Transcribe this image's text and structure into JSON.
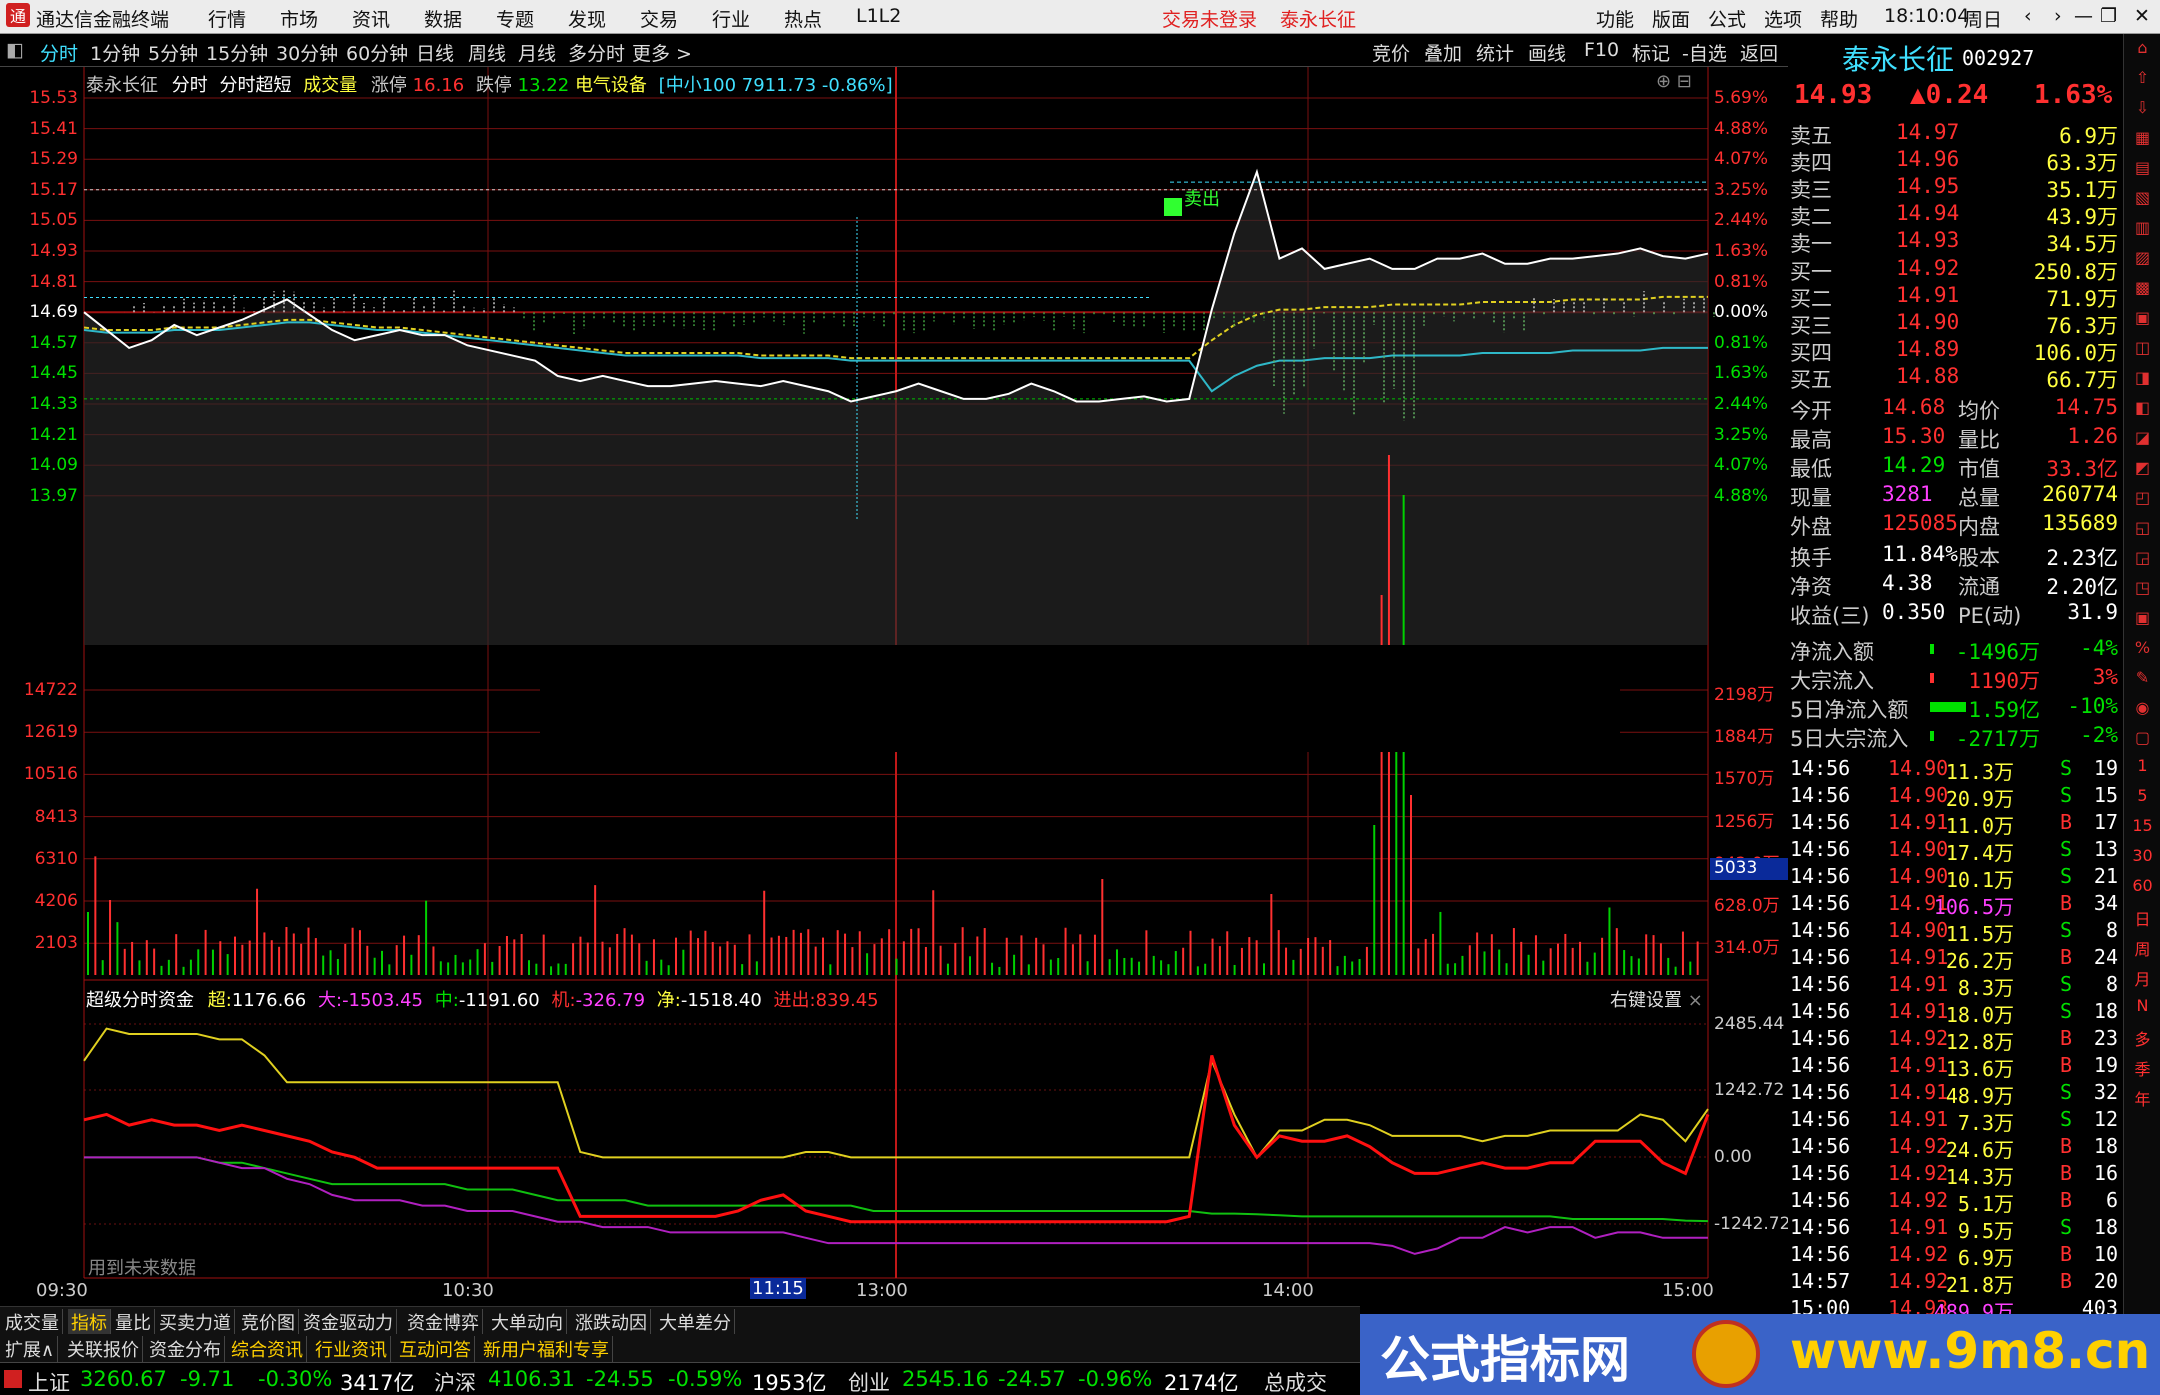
{
  "app": {
    "title": "通达信金融终端",
    "login_status": "交易未登录",
    "stock_link": "泰永长征",
    "time": "18:10:04",
    "weekday": "周日"
  },
  "menu": [
    "行情",
    "市场",
    "资讯",
    "数据",
    "专题",
    "发现",
    "交易",
    "行业",
    "热点",
    "L1L2"
  ],
  "menu_right": [
    "功能",
    "版面",
    "公式",
    "选项",
    "帮助"
  ],
  "periods": [
    "分时",
    "1分钟",
    "5分钟",
    "15分钟",
    "30分钟",
    "60分钟",
    "日线",
    "周线",
    "月线",
    "多分时",
    "更多 >"
  ],
  "tools": [
    "竞价",
    "叠加",
    "统计",
    "画线",
    "F10",
    "标记",
    "-自选",
    "返回"
  ],
  "chart_header": {
    "name": "泰永长征",
    "mode": "分时",
    "mode2": "分时超短",
    "vol_label": "成交量",
    "zt_label": "涨停",
    "zt": "16.16",
    "dt_label": "跌停",
    "dt": "13.22",
    "sector": "电气设备",
    "index": "[中小100 7911.73 -0.86%]"
  },
  "price_axis": [
    "15.53",
    "15.41",
    "15.29",
    "15.17",
    "15.05",
    "14.93",
    "14.81",
    "14.69",
    "14.57",
    "14.45",
    "14.33",
    "14.21",
    "14.09",
    "13.97"
  ],
  "pct_axis": [
    "5.69%",
    "4.88%",
    "4.07%",
    "3.25%",
    "2.44%",
    "1.63%",
    "0.81%",
    "0.00%",
    "0.81%",
    "1.63%",
    "2.44%",
    "3.25%",
    "4.07%",
    "4.88%"
  ],
  "vol_axis_left": [
    "14722",
    "12619",
    "10516",
    "8413",
    "6310",
    "4206",
    "2103"
  ],
  "vol_axis_right": [
    "2198万",
    "1884万",
    "1570万",
    "1256万",
    "942.0万",
    "628.0万",
    "314.0万"
  ],
  "vol_badge": "5033",
  "fund_axis": [
    "2485.44",
    "1242.72",
    "0.00",
    "-1242.72"
  ],
  "fund_legend": {
    "title": "超级分时资金",
    "super_label": "超:",
    "super": "1176.66",
    "big_label": "大:",
    "big": "-1503.45",
    "mid_label": "中:",
    "mid": "-1191.60",
    "inst_label": "机:",
    "inst": "-326.79",
    "net_label": "净:",
    "net": "-1518.40",
    "in_out_label": "进出:",
    "in_out": "839.45",
    "settings": "右键设置"
  },
  "future_note": "用到未来数据",
  "time_axis": [
    "09:30",
    "10:30",
    "11:15",
    "13:00",
    "14:00",
    "15:00"
  ],
  "signal_label": "卖出",
  "quote": {
    "name": "泰永长征",
    "code": "002927",
    "price": "14.93",
    "change": "▲0.24",
    "pct": "1.63%",
    "asks": [
      [
        "卖五",
        "14.97",
        "6.9万"
      ],
      [
        "卖四",
        "14.96",
        "63.3万"
      ],
      [
        "卖三",
        "14.95",
        "35.1万"
      ],
      [
        "卖二",
        "14.94",
        "43.9万"
      ],
      [
        "卖一",
        "14.93",
        "34.5万"
      ]
    ],
    "bids": [
      [
        "买一",
        "14.92",
        "250.8万"
      ],
      [
        "买二",
        "14.91",
        "71.9万"
      ],
      [
        "买三",
        "14.90",
        "76.3万"
      ],
      [
        "买四",
        "14.89",
        "106.0万"
      ],
      [
        "买五",
        "14.88",
        "66.7万"
      ]
    ],
    "stats": [
      [
        "今开",
        "14.68",
        "均价",
        "14.75"
      ],
      [
        "最高",
        "15.30",
        "量比",
        "1.26"
      ],
      [
        "最低",
        "14.29",
        "市值",
        "33.3亿"
      ],
      [
        "现量",
        "3281",
        "总量",
        "260774"
      ],
      [
        "外盘",
        "125085",
        "内盘",
        "135689"
      ]
    ],
    "stats2": [
      [
        "换手",
        "11.84%",
        "股本",
        "2.23亿"
      ],
      [
        "净资",
        "4.38",
        "流通",
        "2.20亿"
      ],
      [
        "收益(三)",
        "0.350",
        "PE(动)",
        "31.9"
      ]
    ],
    "flows": [
      [
        "净流入额",
        "-1496万",
        "-4%"
      ],
      [
        "大宗流入",
        "1190万",
        "3%"
      ],
      [
        "5日净流入额",
        "-1.59亿",
        "-10%"
      ],
      [
        "5日大宗流入",
        "-2717万",
        "-2%"
      ]
    ],
    "ticks": [
      [
        "14:56",
        "14.90",
        "11.3万",
        "S",
        "19"
      ],
      [
        "14:56",
        "14.90",
        "20.9万",
        "S",
        "15"
      ],
      [
        "14:56",
        "14.91",
        "11.0万",
        "B",
        "17"
      ],
      [
        "14:56",
        "14.90",
        "17.4万",
        "S",
        "13"
      ],
      [
        "14:56",
        "14.90",
        "10.1万",
        "S",
        "21"
      ],
      [
        "14:56",
        "14.91",
        "106.5万",
        "B",
        "34"
      ],
      [
        "14:56",
        "14.90",
        "11.5万",
        "S",
        "8"
      ],
      [
        "14:56",
        "14.91",
        "26.2万",
        "B",
        "24"
      ],
      [
        "14:56",
        "14.91",
        "8.3万",
        "S",
        "8"
      ],
      [
        "14:56",
        "14.91",
        "18.0万",
        "S",
        "18"
      ],
      [
        "14:56",
        "14.92",
        "12.8万",
        "B",
        "23"
      ],
      [
        "14:56",
        "14.91",
        "13.6万",
        "B",
        "19"
      ],
      [
        "14:56",
        "14.91",
        "48.9万",
        "S",
        "32"
      ],
      [
        "14:56",
        "14.91",
        "7.3万",
        "S",
        "12"
      ],
      [
        "14:56",
        "14.92",
        "24.6万",
        "B",
        "18"
      ],
      [
        "14:56",
        "14.92",
        "14.3万",
        "B",
        "16"
      ],
      [
        "14:56",
        "14.92",
        "5.1万",
        "B",
        "6"
      ],
      [
        "14:56",
        "14.91",
        "9.5万",
        "S",
        "18"
      ],
      [
        "14:56",
        "14.92",
        "6.9万",
        "B",
        "10"
      ],
      [
        "14:57",
        "14.92",
        "21.8万",
        "B",
        "20"
      ],
      [
        "15:00",
        "14.93",
        "489.9万",
        "",
        "403"
      ]
    ]
  },
  "side_icons": [
    "nav-up-icon",
    "nav-up2-icon",
    "nav-down-icon",
    "chart1-icon",
    "chart2-icon",
    "chart3-icon",
    "chart4-icon",
    "chart5-icon",
    "chart6-icon",
    "f10-icon",
    "f9-icon",
    "f2-icon",
    "f3-icon",
    "f4-icon",
    "f5-icon",
    "f6-icon",
    "f7-icon",
    "f8-icon",
    "f11-icon",
    "f12-icon",
    "pct-icon",
    "pen-icon",
    "zoom-icon",
    "f13-icon"
  ],
  "side_labels": [
    "1",
    "5",
    "15",
    "30",
    "60",
    "日",
    "周",
    "月",
    "N",
    "多",
    "季",
    "年"
  ],
  "bottom_tabs": [
    "成交量",
    "指标",
    "量比",
    "买卖力道",
    "竞价图",
    "资金驱动力",
    "资金博弈",
    "大单动向",
    "涨跌动因",
    "大单差分"
  ],
  "bottom_tabs2": [
    "扩展∧",
    "关联报价",
    "资金分布",
    "综合资讯",
    "行业资讯",
    "互动问答",
    "新用户福利专享"
  ],
  "status": [
    {
      "name": "上证",
      "val": "3260.67",
      "chg": "-9.71",
      "pct": "-0.30%",
      "amt": "3417亿"
    },
    {
      "name": "沪深",
      "val": "4106.31",
      "chg": "-24.55",
      "pct": "-0.59%",
      "amt": "1953亿"
    },
    {
      "name": "创业",
      "val": "2545.16",
      "chg": "-24.57",
      "pct": "-0.96%",
      "amt": "2174亿"
    }
  ],
  "status_tail": "总成交",
  "banner": {
    "text1": "公式指标网",
    "text2": "www.9m8.cn"
  },
  "chart_data": {
    "type": "line",
    "title": "泰永长征 分时",
    "prev_close": 14.69,
    "ylim": [
      13.97,
      15.53
    ],
    "price": [
      14.69,
      14.62,
      14.55,
      14.58,
      14.64,
      14.6,
      14.63,
      14.66,
      14.7,
      14.74,
      14.68,
      14.62,
      14.58,
      14.6,
      14.62,
      14.6,
      14.6,
      14.56,
      14.54,
      14.52,
      14.5,
      14.44,
      14.42,
      14.44,
      14.42,
      14.4,
      14.4,
      14.41,
      14.42,
      14.41,
      14.4,
      14.42,
      14.4,
      14.38,
      14.34,
      14.36,
      14.38,
      14.41,
      14.38,
      14.35,
      14.35,
      14.37,
      14.41,
      14.38,
      14.34,
      14.34,
      14.35,
      14.36,
      14.34,
      14.35,
      14.7,
      15.0,
      15.24,
      14.9,
      14.94,
      14.86,
      14.88,
      14.9,
      14.86,
      14.86,
      14.9,
      14.9,
      14.92,
      14.88,
      14.88,
      14.9,
      14.9,
      14.91,
      14.92,
      14.94,
      14.91,
      14.9,
      14.92
    ],
    "avg": [
      14.63,
      14.62,
      14.62,
      14.62,
      14.63,
      14.63,
      14.63,
      14.64,
      14.65,
      14.66,
      14.66,
      14.65,
      14.64,
      14.63,
      14.63,
      14.62,
      14.61,
      14.6,
      14.59,
      14.58,
      14.57,
      14.56,
      14.55,
      14.54,
      14.53,
      14.53,
      14.53,
      14.53,
      14.53,
      14.53,
      14.52,
      14.52,
      14.52,
      14.52,
      14.51,
      14.51,
      14.51,
      14.51,
      14.51,
      14.51,
      14.51,
      14.51,
      14.51,
      14.51,
      14.51,
      14.51,
      14.51,
      14.51,
      14.51,
      14.51,
      14.58,
      14.64,
      14.68,
      14.7,
      14.7,
      14.71,
      14.71,
      14.71,
      14.72,
      14.72,
      14.72,
      14.72,
      14.73,
      14.73,
      14.73,
      14.73,
      14.74,
      14.74,
      14.74,
      14.74,
      14.75,
      14.75,
      14.75
    ],
    "vol_ylim": [
      0,
      16825
    ],
    "fund_ylim": [
      -1600,
      2600
    ],
    "super": [
      1800,
      2400,
      2300,
      2300,
      2300,
      2300,
      2200,
      2200,
      1900,
      1400,
      1400,
      1400,
      1400,
      1400,
      1400,
      1400,
      1400,
      1400,
      1400,
      1400,
      1400,
      1400,
      100,
      0,
      0,
      0,
      0,
      0,
      0,
      0,
      0,
      0,
      100,
      100,
      0,
      0,
      0,
      0,
      0,
      0,
      0,
      0,
      0,
      0,
      0,
      0,
      0,
      0,
      0,
      0,
      1800,
      800,
      0,
      500,
      500,
      700,
      700,
      600,
      400,
      400,
      400,
      400,
      300,
      400,
      400,
      500,
      500,
      500,
      500,
      800,
      700,
      300,
      900
    ],
    "net": [
      700,
      800,
      600,
      700,
      600,
      600,
      500,
      600,
      500,
      400,
      300,
      100,
      0,
      -200,
      -200,
      -200,
      -200,
      -200,
      -200,
      -200,
      -200,
      -200,
      -1100,
      -1100,
      -1100,
      -1100,
      -1100,
      -1100,
      -1100,
      -1000,
      -800,
      -700,
      -1000,
      -1100,
      -1200,
      -1200,
      -1200,
      -1200,
      -1200,
      -1200,
      -1200,
      -1200,
      -1200,
      -1200,
      -1200,
      -1200,
      -1200,
      -1200,
      -1200,
      -1100,
      1900,
      600,
      0,
      400,
      300,
      300,
      400,
      200,
      -100,
      -300,
      -300,
      -200,
      -100,
      -200,
      -200,
      -100,
      -100,
      300,
      300,
      300,
      -100,
      -300,
      800
    ],
    "mid": [
      0,
      0,
      0,
      0,
      0,
      0,
      -100,
      -100,
      -200,
      -300,
      -400,
      -500,
      -500,
      -500,
      -500,
      -500,
      -500,
      -600,
      -600,
      -600,
      -700,
      -800,
      -800,
      -800,
      -800,
      -900,
      -900,
      -900,
      -900,
      -900,
      -900,
      -900,
      -900,
      -900,
      -900,
      -1000,
      -1000,
      -1000,
      -1000,
      -1000,
      -1000,
      -1000,
      -1000,
      -1000,
      -1000,
      -1000,
      -1000,
      -1000,
      -1000,
      -1000,
      -1050,
      -1050,
      -1060,
      -1080,
      -1100,
      -1100,
      -1100,
      -1100,
      -1100,
      -1100,
      -1100,
      -1100,
      -1100,
      -1100,
      -1100,
      -1100,
      -1150,
      -1150,
      -1150,
      -1150,
      -1150,
      -1180,
      -1190
    ],
    "big": [
      0,
      0,
      0,
      0,
      0,
      0,
      -100,
      -200,
      -200,
      -400,
      -500,
      -700,
      -800,
      -800,
      -800,
      -900,
      -900,
      -1000,
      -1000,
      -1000,
      -1100,
      -1200,
      -1200,
      -1300,
      -1300,
      -1300,
      -1400,
      -1400,
      -1400,
      -1400,
      -1400,
      -1400,
      -1500,
      -1600,
      -1600,
      -1600,
      -1600,
      -1600,
      -1600,
      -1600,
      -1600,
      -1600,
      -1600,
      -1600,
      -1600,
      -1600,
      -1600,
      -1600,
      -1600,
      -1600,
      -1600,
      -1600,
      -1600,
      -1600,
      -1600,
      -1600,
      -1600,
      -1600,
      -1650,
      -1800,
      -1700,
      -1500,
      -1500,
      -1300,
      -1400,
      -1300,
      -1300,
      -1500,
      -1400,
      -1400,
      -1500,
      -1500,
      -1500
    ]
  }
}
